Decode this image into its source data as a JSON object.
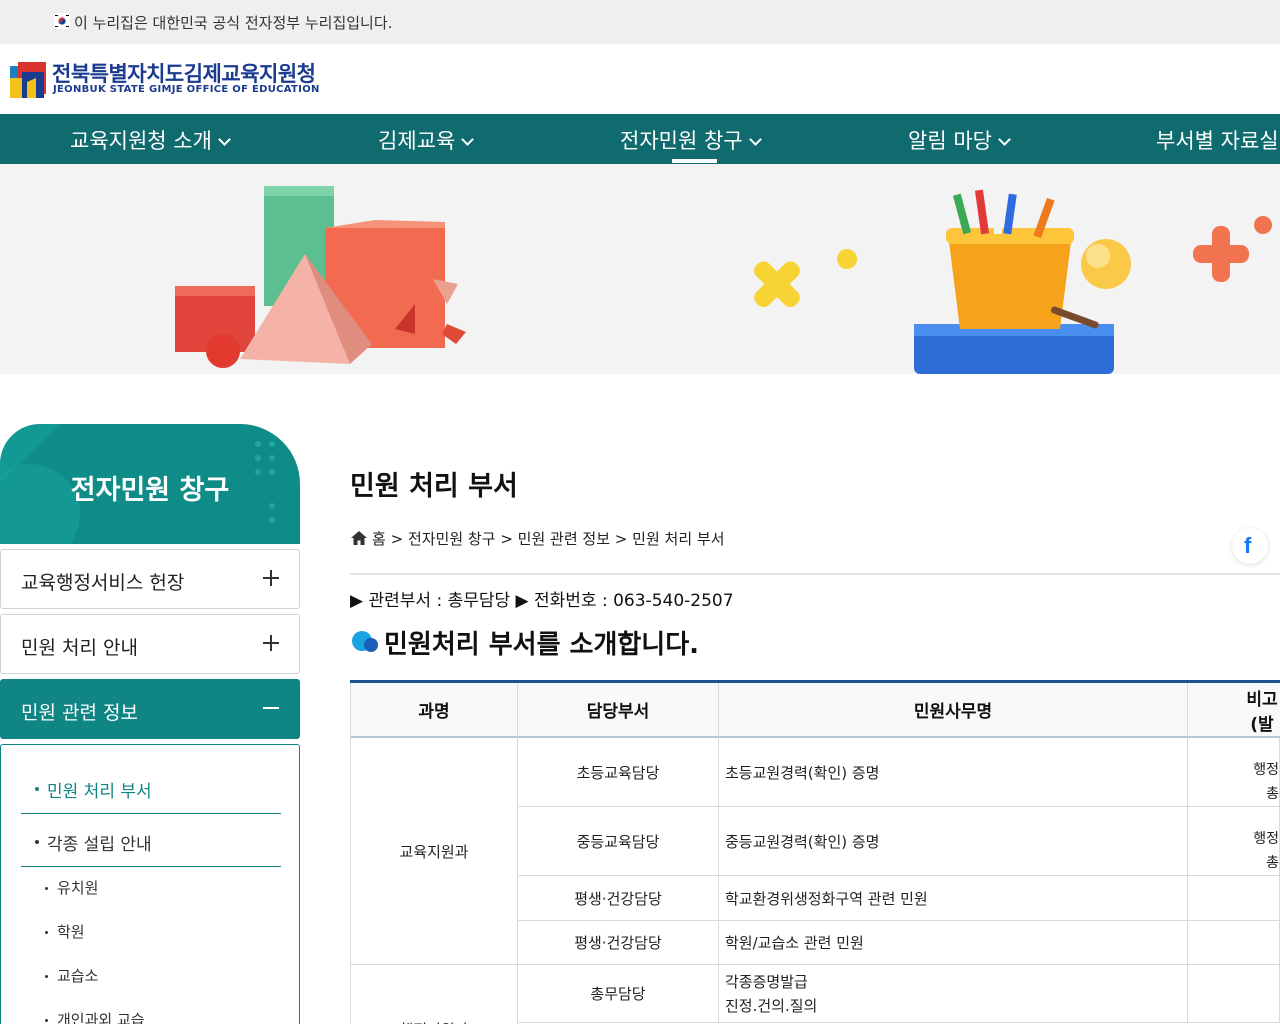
{
  "gov_banner": {
    "text": "이 누리집은 대한민국 공식 전자정부 누리집입니다."
  },
  "logo": {
    "name_ko": "전북특별자치도김제교육지원청",
    "name_en": "JEONBUK STATE GIMJE OFFICE OF EDUCATION"
  },
  "nav": {
    "items": [
      {
        "label": "교육지원청 소개"
      },
      {
        "label": "김제교육"
      },
      {
        "label": "전자민원 창구"
      },
      {
        "label": "알림 마당"
      },
      {
        "label": "부서별 자료실"
      }
    ]
  },
  "sidebar": {
    "title": "전자민원 창구",
    "items": [
      {
        "label": "교육행정서비스 헌장",
        "state": "plus"
      },
      {
        "label": "민원 처리 안내",
        "state": "plus"
      },
      {
        "label": "민원 관련 정보",
        "state": "minus"
      }
    ],
    "sub_items": [
      {
        "label": "민원 처리 부서"
      },
      {
        "label": "각종 설립 안내"
      }
    ],
    "sub_sub_items": [
      {
        "label": "유치원"
      },
      {
        "label": "학원"
      },
      {
        "label": "교습소"
      },
      {
        "label": "개인과외 교습"
      }
    ]
  },
  "content": {
    "page_title": "민원 처리 부서",
    "breadcrumb": {
      "home": "홈",
      "sep": ">",
      "path": [
        "전자민원 창구",
        "민원 관련 정보",
        "민원 처리 부서"
      ]
    },
    "info_line": "▶ 관련부서 : 총무담당 ▶ 전화번호 : 063-540-2507",
    "section_title": "민원처리 부서를 소개합니다.",
    "table": {
      "headers": [
        "과명",
        "담당부서",
        "민원사무명",
        "비고(발"
      ],
      "rows": [
        {
          "dept": "교육지원과",
          "team": "초등교육담당",
          "task": "초등교원경력(확인) 증명",
          "note": [
            "행정",
            "총"
          ]
        },
        {
          "dept": "",
          "team": "중등교육담당",
          "task": "중등교원경력(확인) 증명",
          "note": [
            "행정",
            "총"
          ]
        },
        {
          "dept": "",
          "team": "평생·건강담당",
          "task": "학교환경위생정화구역 관련 민원",
          "note": []
        },
        {
          "dept": "",
          "team": "평생·건강담당",
          "task": "학원/교습소 관련 민원",
          "note": []
        },
        {
          "dept": "행정지원과",
          "team": "총무담당",
          "task": [
            "각종증명발급",
            "진정.건의.질의"
          ],
          "note": []
        }
      ]
    }
  },
  "colors": {
    "nav_bg": "#0f6b6e",
    "sidebar_accent": "#0f8584",
    "table_top": "#1d4f91",
    "logo_blue": "#1b3b8f"
  }
}
